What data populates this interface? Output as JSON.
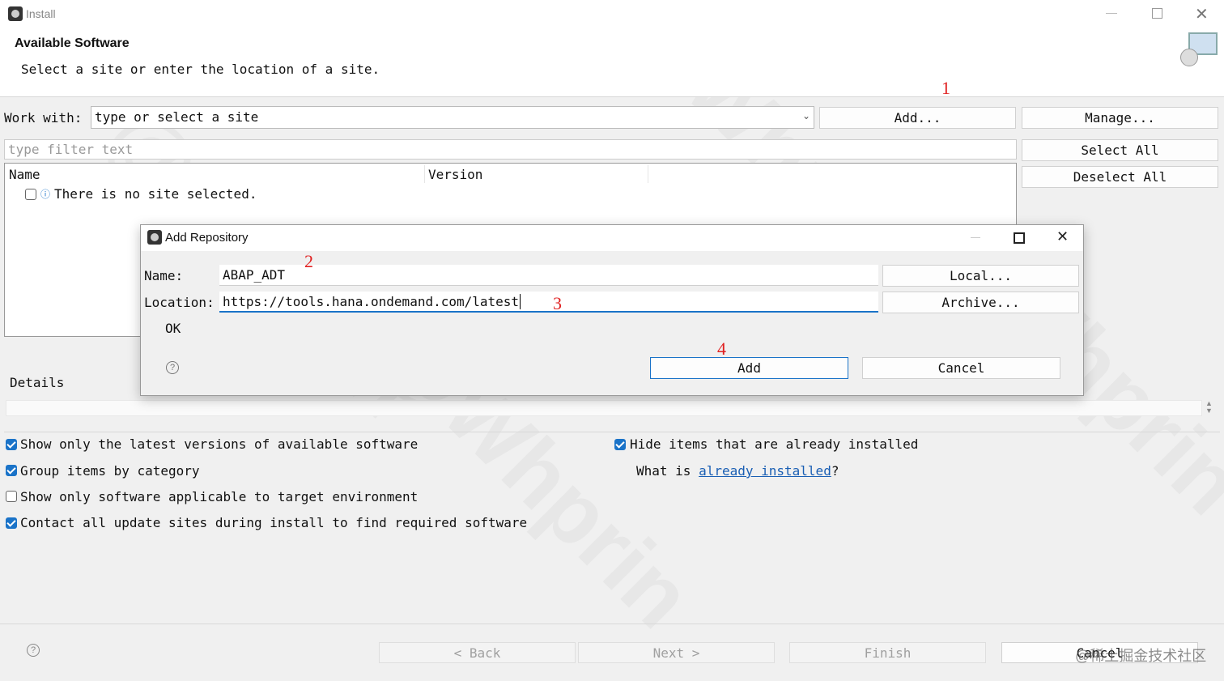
{
  "window": {
    "title": "Install"
  },
  "header": {
    "title": "Available Software",
    "subtitle": "Select a site or enter the location of a site."
  },
  "work_with": {
    "label": "Work with:",
    "value": "type or select a site",
    "add_label": "Add...",
    "manage_label": "Manage..."
  },
  "filter": {
    "placeholder": "type filter text"
  },
  "side_buttons": {
    "select_all": "Select All",
    "deselect_all": "Deselect All"
  },
  "table": {
    "columns": [
      "Name",
      "Version"
    ],
    "empty_message": "There is no site selected."
  },
  "details": {
    "label": "Details"
  },
  "options": {
    "latest_only": "Show only the latest versions of available software",
    "group_by_category": "Group items by category",
    "target_env": "Show only software applicable to target environment",
    "contact_all": "Contact all update sites during install to find required software",
    "hide_installed": "Hide items that are already installed",
    "what_is_prefix": "What is ",
    "what_is_link": "already installed",
    "what_is_suffix": "?"
  },
  "footer": {
    "back": "< Back",
    "next": "Next >",
    "finish": "Finish",
    "cancel": "Cancel",
    "watermark": "@稀土掘金技术社区"
  },
  "dialog": {
    "title": "Add Repository",
    "name_label": "Name:",
    "name_value": "ABAP_ADT",
    "location_label": "Location:",
    "location_value": "https://tools.hana.ondemand.com/latest",
    "local_button": "Local...",
    "archive_button": "Archive...",
    "status": "OK",
    "add_button": "Add",
    "cancel_button": "Cancel"
  },
  "annotations": {
    "step1": "1",
    "step2": "2",
    "step3": "3",
    "step4": "4"
  },
  "colors": {
    "accent": "#1a73c8",
    "annotation": "#e02020",
    "link": "#1a5fb4"
  }
}
